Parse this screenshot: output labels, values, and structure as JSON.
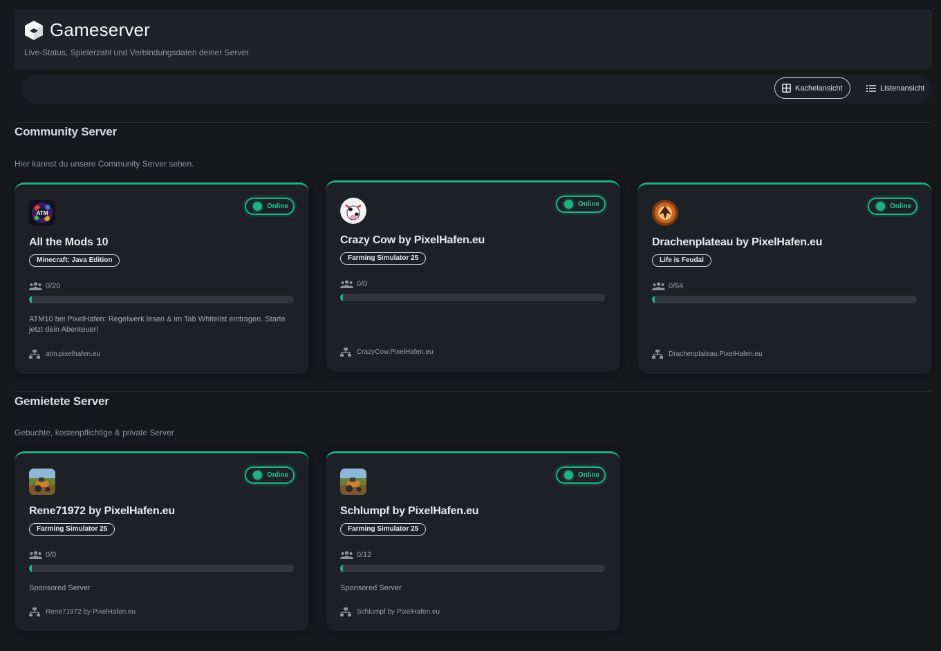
{
  "header": {
    "title": "Gameserver",
    "subtitle": "Live-Status, Spielerzahl und Verbindungsdaten deiner Server."
  },
  "toolbar": {
    "tile_view_label": "Kachelansicht",
    "list_view_label": "Listenansicht"
  },
  "accent_color": "#1fb27f",
  "sections": [
    {
      "title": "Community Server",
      "subtitle": "Hier kannst du unsere Community Server sehen.",
      "servers": [
        {
          "name": "All the Mods 10",
          "game": "Minecraft: Java Edition",
          "status": "Online",
          "players": "0/20",
          "player_fraction": 0,
          "description": "ATM10 bei PixelHafen: Regelwerk lesen & im Tab Whitelist eintragen. Starte jetzt dein Abenteuer!",
          "address": "atm.pixelhafen.eu",
          "logo_text": "ATM"
        },
        {
          "name": "Crazy Cow by PixelHafen.eu",
          "game": "Farming Simulator 25",
          "status": "Online",
          "players": "0/0",
          "player_fraction": 0,
          "description": "",
          "address": "CrazyCow.PixelHafen.eu"
        },
        {
          "name": "Drachenplateau by PixelHafen.eu",
          "game": "Life is Feudal",
          "status": "Online",
          "players": "0/64",
          "player_fraction": 0,
          "description": "",
          "address": "Drachenplateau.PixelHafen.eu"
        }
      ]
    },
    {
      "title": "Gemietete Server",
      "subtitle": "Gebuchte, kostenpflichtige & private Server",
      "servers": [
        {
          "name": "Rene71972 by PixelHafen.eu",
          "game": "Farming Simulator 25",
          "status": "Online",
          "players": "0/0",
          "player_fraction": 0,
          "description": "Sponsored Server",
          "address": "Rene71972 by PixelHafen.eu"
        },
        {
          "name": "Schlumpf by PixelHafen.eu",
          "game": "Farming Simulator 25",
          "status": "Online",
          "players": "0/12",
          "player_fraction": 0,
          "description": "Sponsored Server",
          "address": "Schlumpf by PixelHafen.eu"
        }
      ]
    }
  ]
}
